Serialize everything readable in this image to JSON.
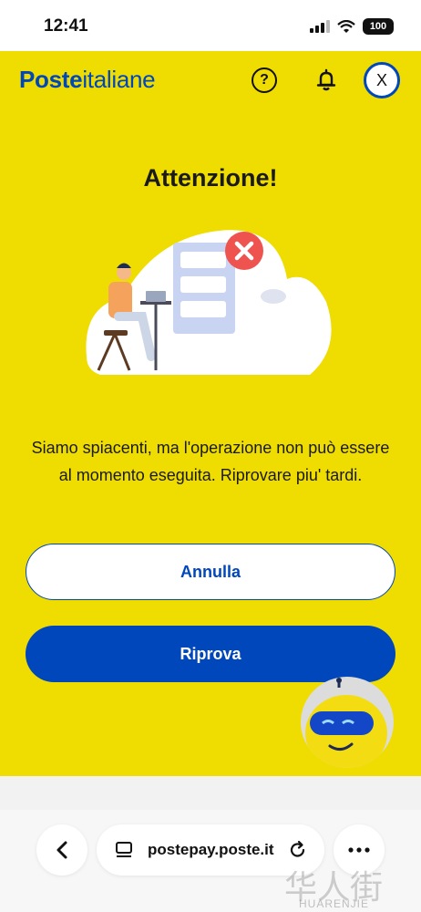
{
  "status_bar": {
    "time": "12:41",
    "battery": "100"
  },
  "header": {
    "logo_bold": "Poste",
    "logo_light": "italiane",
    "help_symbol": "?",
    "avatar_initial": "X"
  },
  "main": {
    "title": "Attenzione!",
    "message": "Siamo spiacenti, ma l'operazione non può essere al momento eseguita. Riprovare piu' tardi.",
    "cancel_label": "Annulla",
    "retry_label": "Riprova"
  },
  "browser": {
    "url": "postepay.poste.it",
    "watermark": "华人街",
    "watermark_sub": "HUARENJIE"
  },
  "colors": {
    "brand_yellow": "#efdc00",
    "brand_blue": "#0047bb",
    "error_red": "#ef5350"
  },
  "icons": [
    "help-icon",
    "bell-icon",
    "back-icon",
    "tab-icon",
    "reload-icon",
    "more-icon",
    "error-x-icon",
    "signal-icon",
    "wifi-icon",
    "battery-icon"
  ]
}
